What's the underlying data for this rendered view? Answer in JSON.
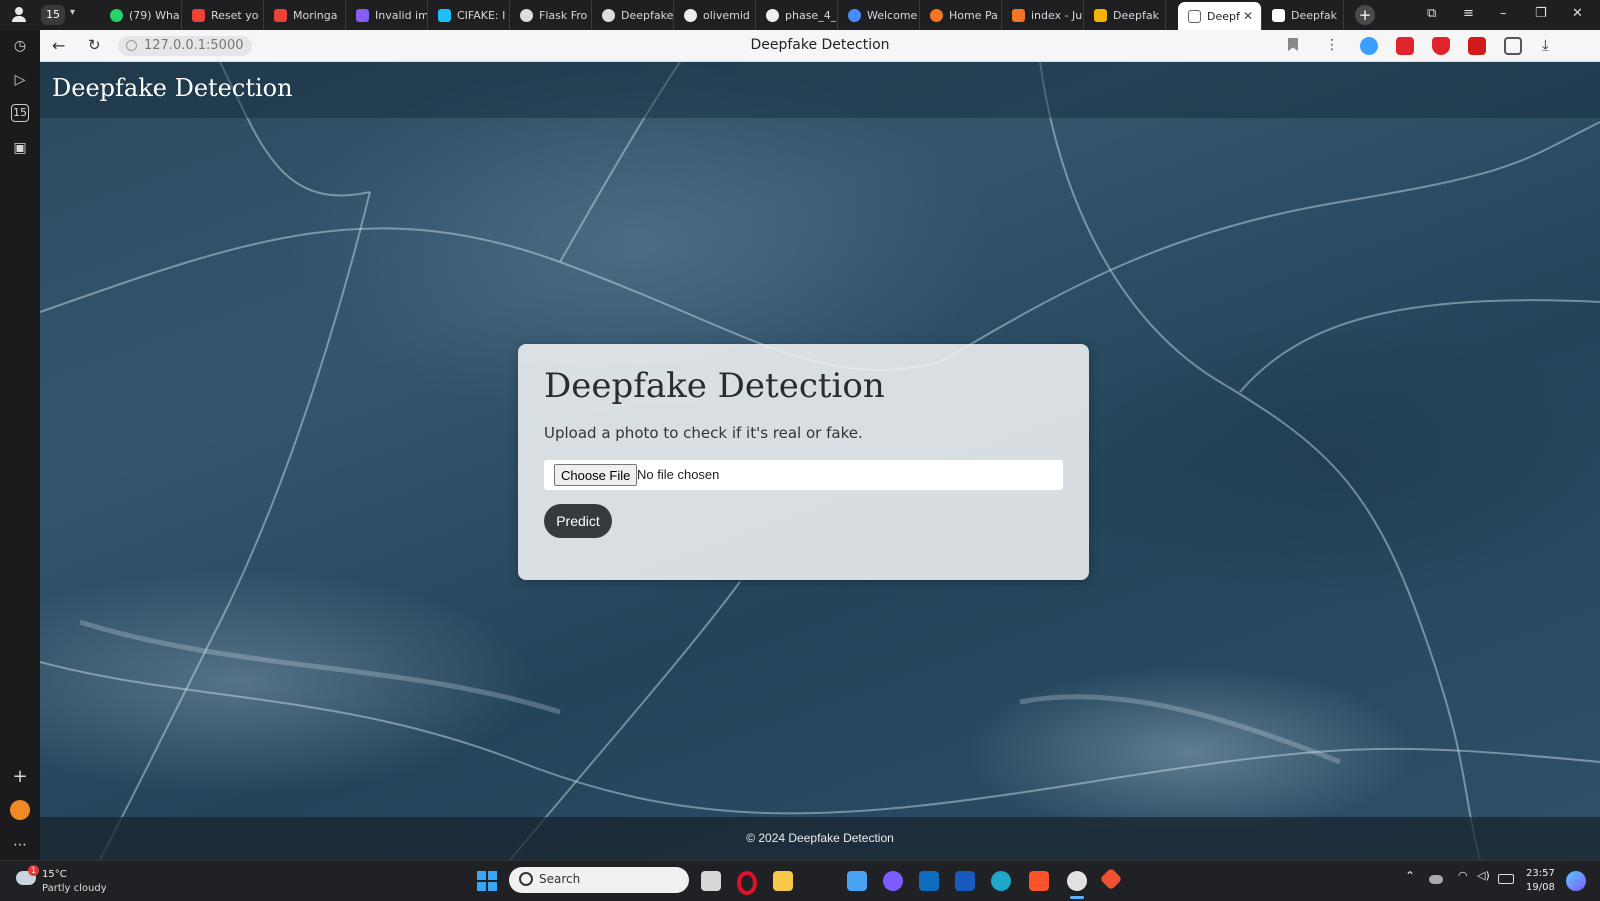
{
  "browser": {
    "tab_count_badge": "15",
    "tabs": [
      {
        "label": "(79) Wha",
        "icon": "whatsapp-icon",
        "color": "#25d366"
      },
      {
        "label": "Reset yo",
        "icon": "gmail-icon",
        "color": "#ea4335"
      },
      {
        "label": "Moringa",
        "icon": "gmail-icon",
        "color": "#ea4335"
      },
      {
        "label": "Invalid im",
        "icon": "hugging-icon",
        "color": "#8a5cf6"
      },
      {
        "label": "CIFAKE: I",
        "icon": "kaggle-icon",
        "color": "#20beff"
      },
      {
        "label": "Flask Fro",
        "icon": "chatgpt-icon",
        "color": "#dddddd"
      },
      {
        "label": "Deepfake",
        "icon": "chatgpt-icon",
        "color": "#dddddd"
      },
      {
        "label": "olivemid",
        "icon": "github-icon",
        "color": "#eeeeee"
      },
      {
        "label": "phase_4_",
        "icon": "github-icon",
        "color": "#eeeeee"
      },
      {
        "label": "Welcome",
        "icon": "copilot-icon",
        "color": "#4a8cff"
      },
      {
        "label": "Home Pa",
        "icon": "jupyter-icon",
        "color": "#f37626"
      },
      {
        "label": "index - Ju",
        "icon": "jupyter-icon",
        "color": "#f37626"
      },
      {
        "label": "Deepfak",
        "icon": "slides-icon",
        "color": "#f4b400"
      },
      {
        "label": "Deepf",
        "icon": "page-icon",
        "color": "#666666",
        "active": true
      },
      {
        "label": "Deepfak",
        "icon": "pen-icon",
        "color": "#ffffff"
      }
    ],
    "address": {
      "url": "127.0.0.1:5000",
      "page_title": "Deepfake Detection"
    },
    "sidebar_badge": "15"
  },
  "page": {
    "header_title": "Deepfake Detection",
    "card": {
      "heading": "Deepfake Detection",
      "subtitle": "Upload a photo to check if it's real or fake.",
      "file_button": "Choose File",
      "file_status": "No file chosen",
      "predict_button": "Predict"
    },
    "footer": "© 2024 Deepfake Detection"
  },
  "taskbar": {
    "weather_temp": "15°C",
    "weather_desc": "Partly cloudy",
    "weather_badge": "1",
    "search_placeholder": "Search",
    "time": "23:57",
    "date": "19/08"
  },
  "colors": {
    "predict_button": "#343a40",
    "background": "#2b4a5f"
  }
}
